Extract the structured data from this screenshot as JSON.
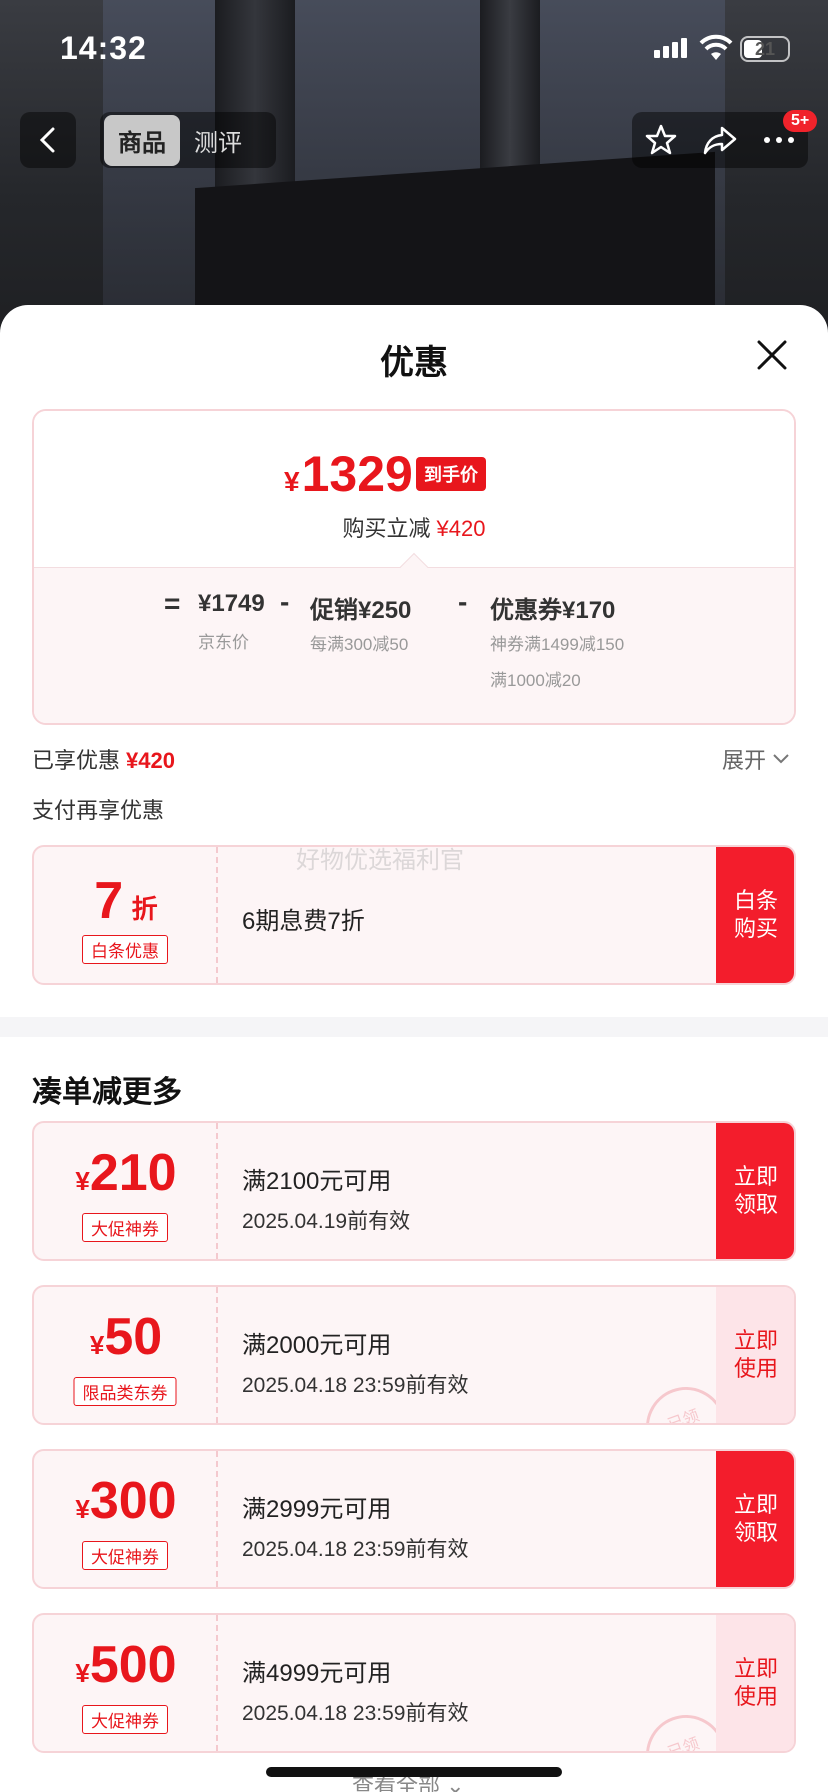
{
  "status_bar": {
    "time": "14:32",
    "battery": "21"
  },
  "top_nav": {
    "tabs": [
      {
        "label": "商品"
      },
      {
        "label": "测评"
      }
    ],
    "badge": "5+"
  },
  "sheet": {
    "title": "优惠"
  },
  "price_card": {
    "currency": "¥",
    "final_price": "1329",
    "final_tag": "到手价",
    "reduce_label": "购买立减",
    "reduce_amount": "¥420",
    "eq": "=",
    "jd_price": "¥1749",
    "jd_label": "京东价",
    "minus1": "-",
    "promo": "促销¥250",
    "promo_sub": "每满300减50",
    "minus2": "-",
    "coupon": "优惠券¥170",
    "coupon_sub1": "神券满1499减150",
    "coupon_sub2": "满1000减20"
  },
  "enjoyed": {
    "label": "已享优惠",
    "amount": "¥420",
    "expand": "展开"
  },
  "pay_more": {
    "label": "支付再享优惠"
  },
  "baitiao": {
    "num": "7",
    "unit": "折",
    "tag": "白条优惠",
    "desc": "6期息费7折",
    "action": "白条购买"
  },
  "watermark": "好物优选福利官",
  "section_title": "凑单减更多",
  "coupons": [
    {
      "yen": "¥",
      "amount": "210",
      "tag": "大促神券",
      "cond": "满2100元可用",
      "valid": "2025.04.19前有效",
      "action": "立即领取",
      "used": false
    },
    {
      "yen": "¥",
      "amount": "50",
      "tag": "限品类东券",
      "cond": "满2000元可用",
      "valid": "2025.04.18 23:59前有效",
      "action": "立即使用",
      "used": true,
      "stamp": "已领"
    },
    {
      "yen": "¥",
      "amount": "300",
      "tag": "大促神券",
      "cond": "满2999元可用",
      "valid": "2025.04.18 23:59前有效",
      "action": "立即领取",
      "used": false
    },
    {
      "yen": "¥",
      "amount": "500",
      "tag": "大促神券",
      "cond": "满4999元可用",
      "valid": "2025.04.18 23:59前有效",
      "action": "立即使用",
      "used": true,
      "stamp": "已领"
    }
  ],
  "see_all": "查看全部"
}
